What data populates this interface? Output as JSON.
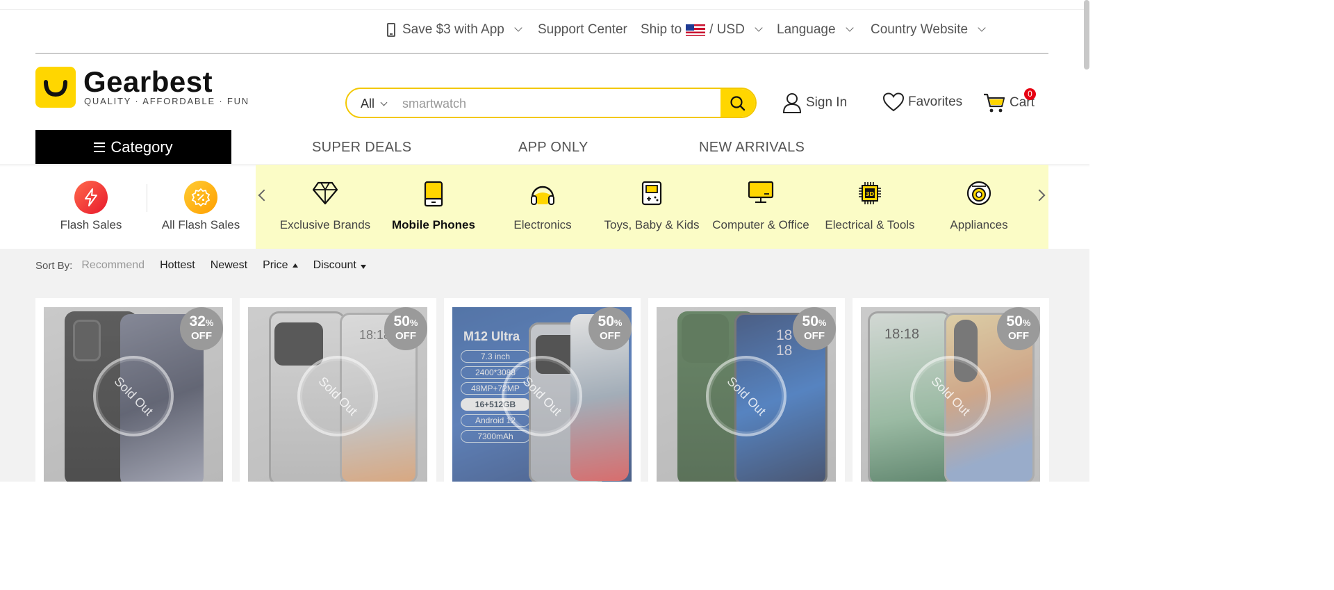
{
  "utility_bar": {
    "app_promo": "Save $3 with App",
    "support": "Support Center",
    "ship_to": "Ship to",
    "currency": "/ USD",
    "language": "Language",
    "country_site": "Country Website"
  },
  "brand": {
    "name": "Gearbest",
    "tagline": "QUALITY · AFFORDABLE · FUN",
    "accent_color": "#ffd600"
  },
  "search": {
    "category": "All",
    "placeholder": "smartwatch"
  },
  "header_actions": {
    "sign_in": "Sign In",
    "favorites": "Favorites",
    "cart": "Cart",
    "cart_count": "0"
  },
  "nav": {
    "category": "Category",
    "links": [
      "SUPER DEALS",
      "APP ONLY",
      "NEW ARRIVALS"
    ]
  },
  "categories": {
    "flash": [
      "Flash Sales",
      "All Flash Sales"
    ],
    "items": [
      {
        "label": "Exclusive Brands",
        "icon": "diamond-icon"
      },
      {
        "label": "Mobile Phones",
        "icon": "mobile-phone-icon",
        "active": true
      },
      {
        "label": "Electronics",
        "icon": "headphones-icon"
      },
      {
        "label": "Toys, Baby & Kids",
        "icon": "game-console-icon"
      },
      {
        "label": "Computer & Office",
        "icon": "monitor-icon"
      },
      {
        "label": "Electrical & Tools",
        "icon": "chip-3d-icon"
      },
      {
        "label": "Appliances",
        "icon": "appliance-icon"
      }
    ]
  },
  "sort": {
    "label": "Sort By:",
    "options": [
      "Recommend",
      "Hottest",
      "Newest",
      "Price",
      "Discount"
    ]
  },
  "products": [
    {
      "discount": "32",
      "unit": "%",
      "off": "OFF",
      "status": "Sold Out"
    },
    {
      "discount": "50",
      "unit": "%",
      "off": "OFF",
      "status": "Sold Out",
      "screen_time": "18:18"
    },
    {
      "discount": "50",
      "unit": "%",
      "off": "OFF",
      "status": "Sold Out",
      "promo_title": "M12 Ultra",
      "specs": [
        "7.3 inch",
        "2400*3088",
        "48MP+72MP",
        "16+512GB",
        "Android 12",
        "7300mAh"
      ]
    },
    {
      "discount": "50",
      "unit": "%",
      "off": "OFF",
      "status": "Sold Out",
      "screen_time": "18 18"
    },
    {
      "discount": "50",
      "unit": "%",
      "off": "OFF",
      "status": "Sold Out",
      "screen_time": "18:18"
    }
  ]
}
